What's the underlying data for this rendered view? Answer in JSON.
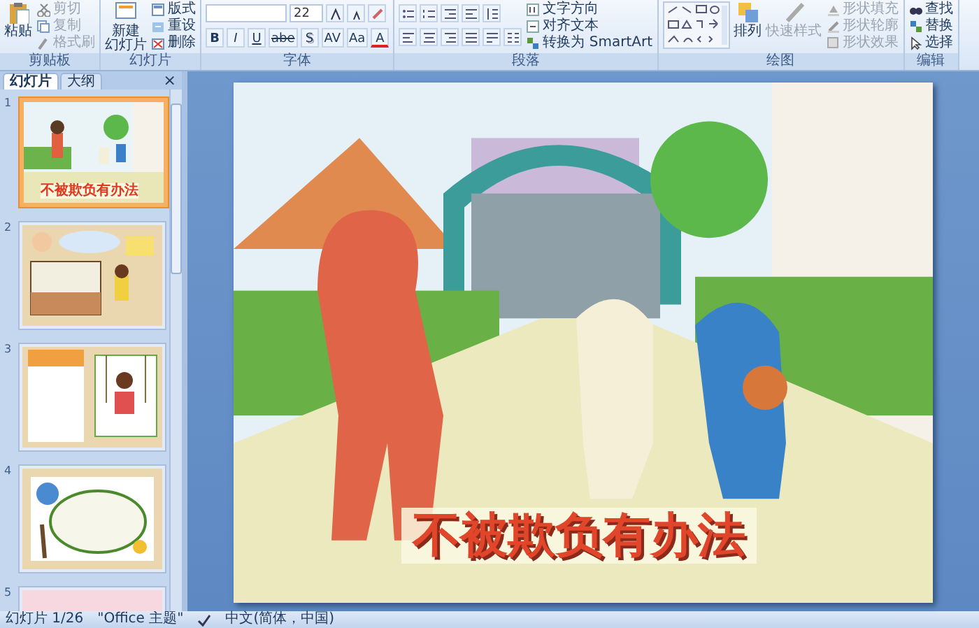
{
  "ribbon": {
    "groups": [
      {
        "kind": "clipboard",
        "label": "剪贴板",
        "large": [
          {
            "label": "粘贴",
            "disabled": false
          }
        ],
        "commands": [
          {
            "label": "剪切",
            "disabled": true
          },
          {
            "label": "复制",
            "disabled": true
          },
          {
            "label": "格式刷",
            "disabled": true
          }
        ]
      },
      {
        "kind": "slides",
        "label": "幻灯片",
        "large": [
          {
            "label": "新建",
            "label_2": "幻灯片",
            "disabled": false
          }
        ],
        "commands": [
          {
            "label": "版式",
            "disabled": false
          },
          {
            "label": "重设",
            "disabled": false
          },
          {
            "label": "删除",
            "disabled": false
          }
        ]
      },
      {
        "kind": "font",
        "label": "字体",
        "size": "22",
        "buttons": [
          "B",
          "I",
          "U",
          "abe",
          "S",
          "AV",
          "Aa",
          "A"
        ]
      },
      {
        "kind": "paragraph",
        "label": "段落",
        "commands": [
          {
            "label": "文字方向",
            "disabled": false
          },
          {
            "label": "对齐文本",
            "disabled": false
          },
          {
            "label": "转换为 SmartArt",
            "disabled": false
          }
        ]
      },
      {
        "kind": "drawing",
        "label": "绘图",
        "large": [
          {
            "label": "排列",
            "disabled": false
          },
          {
            "label": "快速样式",
            "disabled": true
          }
        ],
        "commands": [
          {
            "label": "形状填充",
            "disabled": true
          },
          {
            "label": "形状轮廓",
            "disabled": true
          },
          {
            "label": "形状效果",
            "disabled": true
          }
        ]
      },
      {
        "kind": "editing",
        "label": "编辑",
        "commands": [
          {
            "label": "查找",
            "disabled": false
          },
          {
            "label": "替换",
            "disabled": false
          },
          {
            "label": "选择",
            "disabled": false
          }
        ]
      }
    ]
  },
  "panel": {
    "tabs": [
      {
        "label": "幻灯片",
        "selected": true
      },
      {
        "label": "大纲",
        "selected": false
      }
    ],
    "close": "×",
    "slides": [
      {
        "number": "1",
        "title": "不被欺负有办法",
        "selected": true
      },
      {
        "number": "2",
        "selected": false
      },
      {
        "number": "3",
        "selected": false
      },
      {
        "number": "4",
        "selected": false
      },
      {
        "number": "5",
        "selected": false
      }
    ]
  },
  "slide": {
    "title": "不被欺负有办法"
  },
  "status_bar": {
    "slide": "幻灯片 1/26",
    "theme": "\"Office 主题\"",
    "language": "中文(简体，中国)"
  }
}
